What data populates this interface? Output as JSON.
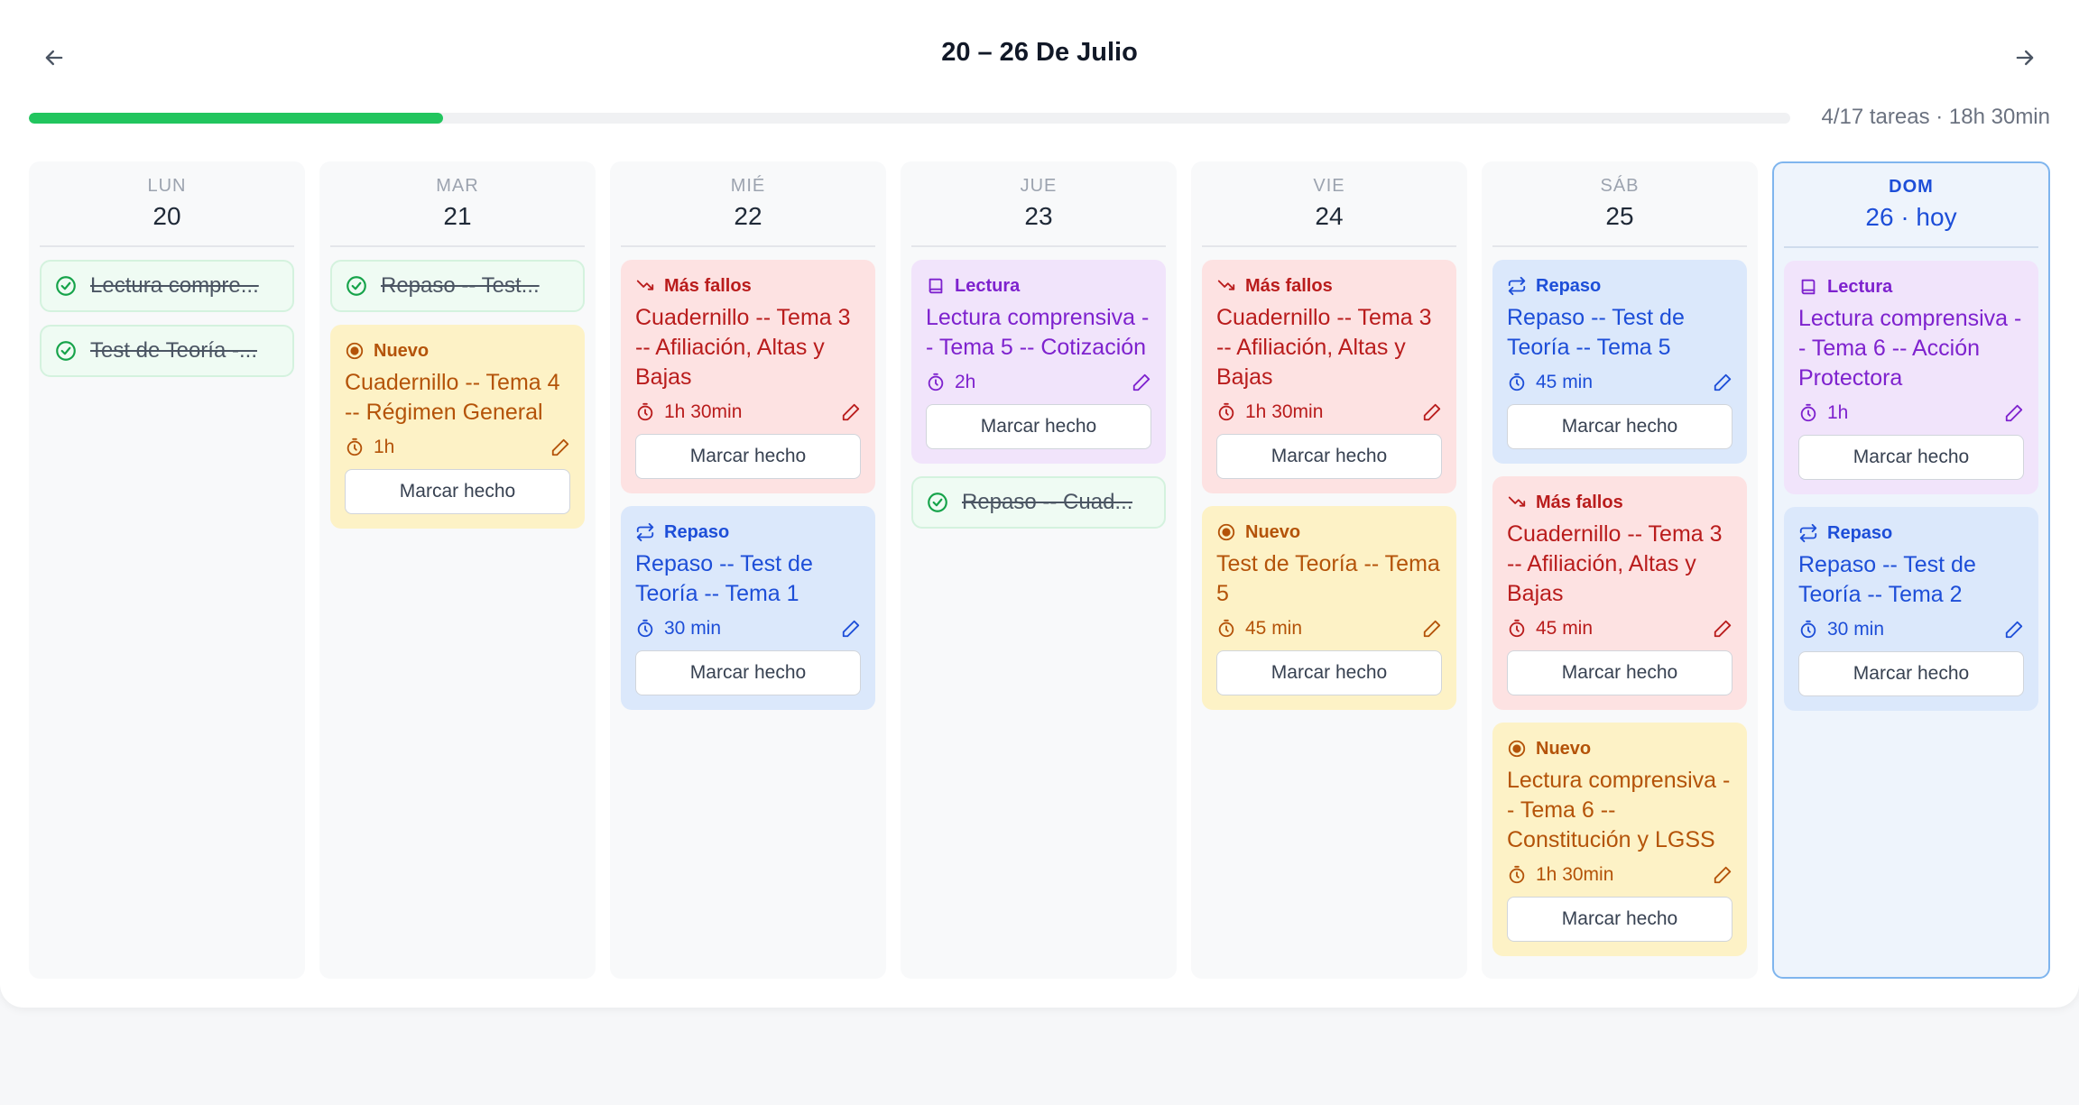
{
  "header": {
    "title": "20 – 26 De Julio",
    "progress_text": "4/17 tareas · 18h 30min",
    "progress_fraction": 0.235
  },
  "labels": {
    "mark_done": "Marcar hecho"
  },
  "days": [
    {
      "dow": "LUN",
      "date": "20",
      "items": [
        {
          "kind": "done",
          "text": "Lectura compre..."
        },
        {
          "kind": "done",
          "text": "Test de Teoría -..."
        }
      ]
    },
    {
      "dow": "MAR",
      "date": "21",
      "items": [
        {
          "kind": "done",
          "text": "Repaso -- Test..."
        },
        {
          "kind": "task",
          "color": "yellow",
          "icon": "target-icon",
          "tag": "Nuevo",
          "title": "Cuadernillo -- Tema 4 -- Régimen General",
          "duration": "1h"
        }
      ]
    },
    {
      "dow": "MIÉ",
      "date": "22",
      "items": [
        {
          "kind": "task",
          "color": "red",
          "icon": "trending-down-icon",
          "tag": "Más fallos",
          "title": "Cuadernillo -- Tema 3 -- Afiliación, Altas y Bajas",
          "duration": "1h 30min"
        },
        {
          "kind": "task",
          "color": "blue",
          "icon": "repeat-icon",
          "tag": "Repaso",
          "title": "Repaso -- Test de Teoría -- Tema 1",
          "duration": "30 min"
        }
      ]
    },
    {
      "dow": "JUE",
      "date": "23",
      "items": [
        {
          "kind": "task",
          "color": "purple",
          "icon": "book-icon",
          "tag": "Lectura",
          "title": "Lectura comprensiva -- Tema 5 -- Cotización",
          "duration": "2h"
        },
        {
          "kind": "done",
          "text": "Repaso -- Cuad..."
        }
      ]
    },
    {
      "dow": "VIE",
      "date": "24",
      "items": [
        {
          "kind": "task",
          "color": "red",
          "icon": "trending-down-icon",
          "tag": "Más fallos",
          "title": "Cuadernillo -- Tema 3 -- Afiliación, Altas y Bajas",
          "duration": "1h 30min"
        },
        {
          "kind": "task",
          "color": "yellow",
          "icon": "target-icon",
          "tag": "Nuevo",
          "title": "Test de Teoría -- Tema 5",
          "duration": "45 min"
        }
      ]
    },
    {
      "dow": "SÁB",
      "date": "25",
      "items": [
        {
          "kind": "task",
          "color": "blue",
          "icon": "repeat-icon",
          "tag": "Repaso",
          "title": "Repaso -- Test de Teoría -- Tema 5",
          "duration": "45 min"
        },
        {
          "kind": "task",
          "color": "red",
          "icon": "trending-down-icon",
          "tag": "Más fallos",
          "title": "Cuadernillo -- Tema 3 -- Afiliación, Altas y Bajas",
          "duration": "45 min"
        },
        {
          "kind": "task",
          "color": "yellow",
          "icon": "target-icon",
          "tag": "Nuevo",
          "title": "Lectura comprensiva -- Tema 6 -- Constitución y LGSS",
          "duration": "1h 30min"
        }
      ]
    },
    {
      "dow": "DOM",
      "date": "26 · hoy",
      "today": true,
      "items": [
        {
          "kind": "task",
          "color": "purple",
          "icon": "book-icon",
          "tag": "Lectura",
          "title": "Lectura comprensiva -- Tema 6 -- Acción Protectora",
          "duration": "1h"
        },
        {
          "kind": "task",
          "color": "blue",
          "icon": "repeat-icon",
          "tag": "Repaso",
          "title": "Repaso -- Test de Teoría -- Tema 2",
          "duration": "30 min"
        }
      ]
    }
  ]
}
